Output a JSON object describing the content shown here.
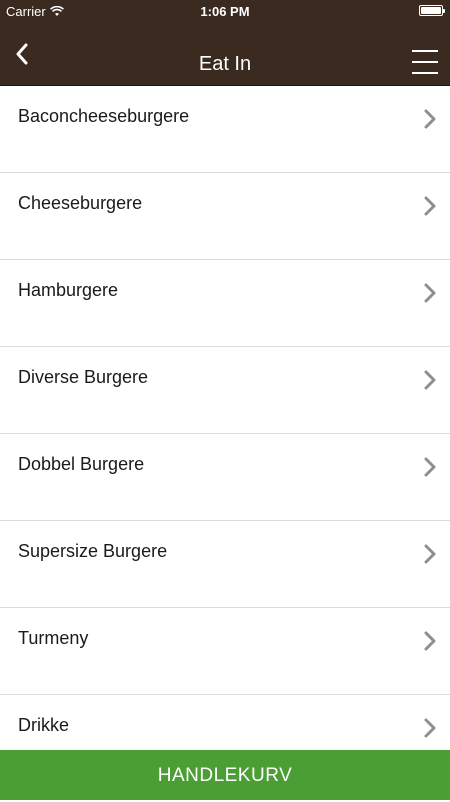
{
  "status_bar": {
    "carrier": "Carrier",
    "time": "1:06 PM"
  },
  "nav": {
    "title": "Eat In"
  },
  "menu_items": [
    {
      "label": "Baconcheeseburgere"
    },
    {
      "label": "Cheeseburgere"
    },
    {
      "label": "Hamburgere"
    },
    {
      "label": "Diverse Burgere"
    },
    {
      "label": "Dobbel Burgere"
    },
    {
      "label": "Supersize Burgere"
    },
    {
      "label": "Turmeny"
    },
    {
      "label": "Drikke"
    }
  ],
  "cart_button": {
    "label": "HANDLEKURV"
  },
  "colors": {
    "header_bg": "#3a2a1f",
    "cart_bg": "#4a9e34"
  }
}
